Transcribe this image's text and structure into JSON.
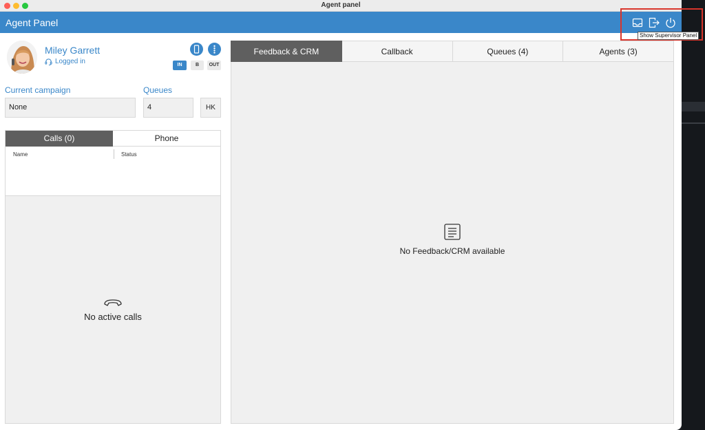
{
  "window": {
    "title": "Agent panel"
  },
  "header": {
    "title": "Agent Panel",
    "icons": [
      "inbox-icon",
      "logout-icon",
      "power-icon"
    ],
    "tooltip": "Show Supervisor Panel"
  },
  "agent": {
    "name": "Miley Garrett",
    "status": "Logged in",
    "state_buttons": {
      "in": "IN",
      "b": "B",
      "out": "OUT"
    }
  },
  "campaign": {
    "label": "Current campaign",
    "value": "None"
  },
  "queues": {
    "label": "Queues",
    "value": "4",
    "hk_label": "HK"
  },
  "calls_panel": {
    "tabs": [
      "Calls (0)",
      "Phone"
    ],
    "columns": [
      "Name",
      "Status"
    ],
    "empty_text": "No active calls"
  },
  "main": {
    "tabs": [
      "Feedback & CRM",
      "Callback",
      "Queues (4)",
      "Agents (3)"
    ],
    "empty_text": "No Feedback/CRM available"
  },
  "colors": {
    "accent": "#3a87c9",
    "active_tab": "#5f5f5f",
    "highlight": "#d9352b"
  }
}
